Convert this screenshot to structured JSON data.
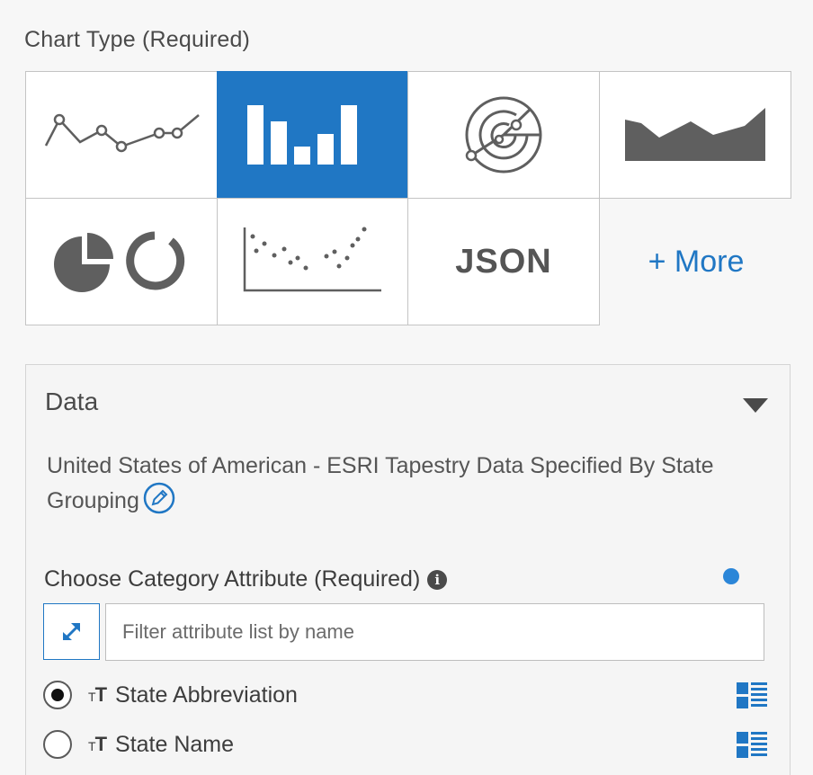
{
  "chart_type": {
    "label": "Chart Type (Required)",
    "tiles": [
      {
        "name": "line",
        "icon": "line-chart-icon",
        "selected": false
      },
      {
        "name": "bar",
        "icon": "bar-chart-icon",
        "selected": true
      },
      {
        "name": "radar",
        "icon": "radar-chart-icon",
        "selected": false
      },
      {
        "name": "area",
        "icon": "area-chart-icon",
        "selected": false
      },
      {
        "name": "pie",
        "icon": "pie-donut-chart-icon",
        "selected": false
      },
      {
        "name": "scatter",
        "icon": "scatter-chart-icon",
        "selected": false
      },
      {
        "name": "json",
        "label": "JSON",
        "selected": false
      }
    ],
    "more_label": "+ More"
  },
  "data_panel": {
    "title": "Data",
    "description": "United States of American - ESRI Tapestry Data Specified By State Grouping",
    "category_label": "Choose Category Attribute (Required)",
    "info_icon": "i",
    "filter_placeholder": "Filter attribute list by name",
    "attributes": [
      {
        "type_small": "T",
        "type_large": "T",
        "label": "State Abbreviation",
        "selected": true
      },
      {
        "type_small": "T",
        "type_large": "T",
        "label": "State Name",
        "selected": false
      }
    ]
  },
  "colors": {
    "accent": "#2077c4",
    "tile_border": "#c4c4c4",
    "icon_gray": "#5f5f5f"
  }
}
